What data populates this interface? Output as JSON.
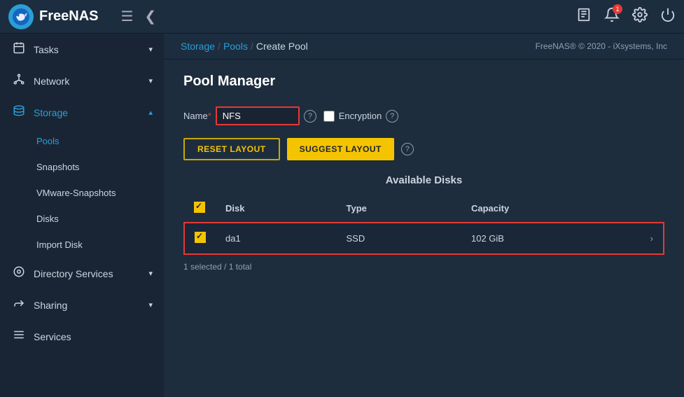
{
  "topnav": {
    "logo_text": "FreeNAS",
    "menu_icon": "☰",
    "back_icon": "❮",
    "notes_icon": "📋",
    "bell_icon": "🔔",
    "bell_badge": "1",
    "gear_icon": "⚙",
    "power_icon": "⏻"
  },
  "breadcrumb": {
    "storage": "Storage",
    "pools": "Pools",
    "current": "Create Pool",
    "copyright": "FreeNAS® © 2020 - iXsystems, Inc"
  },
  "sidebar": {
    "items": [
      {
        "id": "tasks",
        "icon": "📅",
        "label": "Tasks",
        "arrow": "▾"
      },
      {
        "id": "network",
        "icon": "🔗",
        "label": "Network",
        "arrow": "▾"
      },
      {
        "id": "storage",
        "icon": "☰",
        "label": "Storage",
        "arrow": "▴",
        "active": true
      },
      {
        "id": "pools",
        "label": "Pools",
        "sub": true,
        "active": true
      },
      {
        "id": "snapshots",
        "label": "Snapshots",
        "sub": true
      },
      {
        "id": "vmware-snapshots",
        "label": "VMware-Snapshots",
        "sub": true
      },
      {
        "id": "disks",
        "label": "Disks",
        "sub": true
      },
      {
        "id": "import-disk",
        "label": "Import Disk",
        "sub": true
      },
      {
        "id": "directory-services",
        "icon": "◎",
        "label": "Directory Services",
        "arrow": "▾"
      },
      {
        "id": "sharing",
        "icon": "⤢",
        "label": "Sharing",
        "arrow": "▾"
      },
      {
        "id": "services",
        "icon": "≡",
        "label": "Services"
      }
    ]
  },
  "pool_manager": {
    "title": "Pool Manager",
    "name_label": "Name",
    "name_required": "*",
    "name_value": "NFS",
    "name_placeholder": "",
    "help_icon": "?",
    "encryption_label": "Encryption",
    "reset_layout_label": "RESET LAYOUT",
    "suggest_layout_label": "SUGGEST LAYOUT",
    "available_disks_title": "Available Disks",
    "table_headers": {
      "check": "",
      "disk": "Disk",
      "type": "Type",
      "capacity": "Capacity"
    },
    "disks": [
      {
        "id": "da1",
        "name": "da1",
        "type": "SSD",
        "capacity": "102 GiB",
        "checked": true
      }
    ],
    "selected_count": "1 selected / 1 total"
  }
}
